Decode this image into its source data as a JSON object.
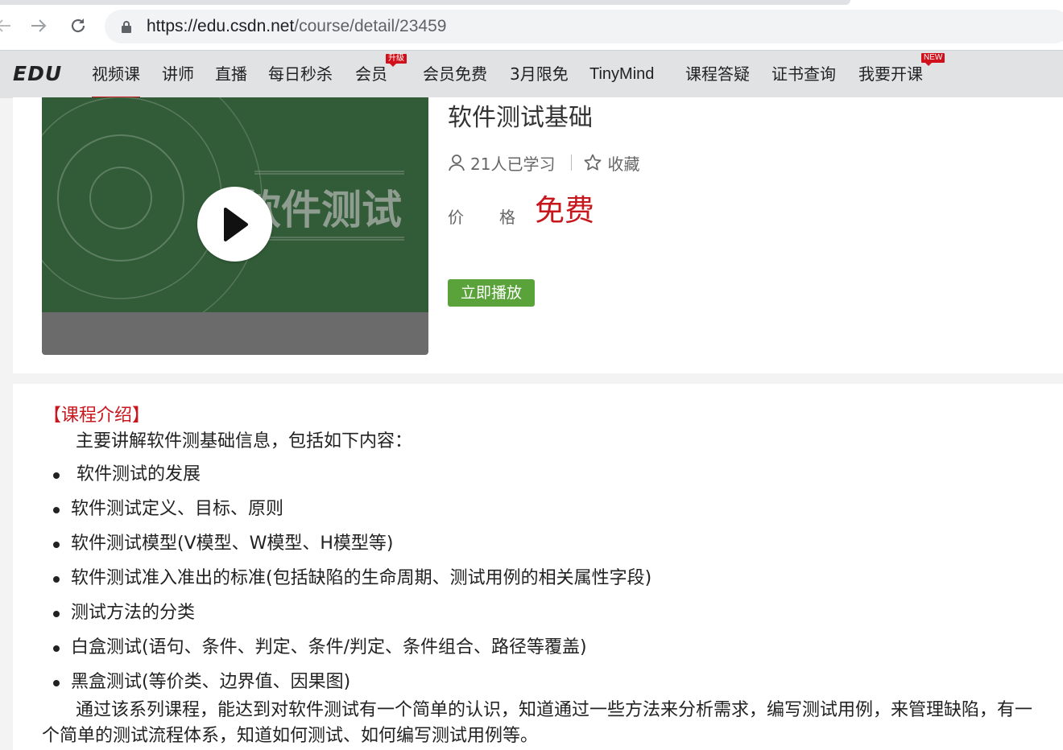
{
  "browser": {
    "url_host": "https://edu.csdn.net",
    "url_path": "/course/detail/23459"
  },
  "site_nav": {
    "logo": "EDU",
    "items": [
      {
        "label": "视频课"
      },
      {
        "label": "讲师"
      },
      {
        "label": "直播"
      },
      {
        "label": "每日秒杀"
      },
      {
        "label": "会员",
        "badge": "升级"
      },
      {
        "label": "会员免费"
      },
      {
        "label": "3月限免"
      },
      {
        "label": "TinyMind"
      },
      {
        "label": "课程答疑"
      },
      {
        "label": "证书查询"
      },
      {
        "label": "我要开课",
        "badge": "NEW"
      }
    ],
    "active_item": "视频课"
  },
  "course": {
    "cover_text": "软件测试",
    "title": "软件测试基础",
    "learners": "21人已学习",
    "favorite": "收藏",
    "price_label_1": "价",
    "price_label_2": "格",
    "price": "免费",
    "play_now": "立即播放"
  },
  "intro": {
    "heading": "【课程介绍】",
    "lead": "主要讲解软件测基础信息，包括如下内容：",
    "items": [
      " 软件测试的发展",
      "软件测试定义、目标、原则",
      "软件测试模型(V模型、W模型、H模型等)",
      "软件测试准入准出的标准(包括缺陷的生命周期、测试用例的相关属性字段)",
      "测试方法的分类",
      "白盒测试(语句、条件、判定、条件/判定、条件组合、路径等覆盖)",
      "黑盒测试(等价类、边界值、因果图)"
    ],
    "closing": "通过该系列课程，能达到对软件测试有一个简单的认识，知道通过一些方法来分析需求，编写测试用例，来管理缺陷，有一个简单的测试流程体系，知道如何测试、如何编写测试用例等。"
  },
  "colors": {
    "accent_red": "#c8161d",
    "play_green": "#5aa33a",
    "cover_green": "#325c38"
  }
}
